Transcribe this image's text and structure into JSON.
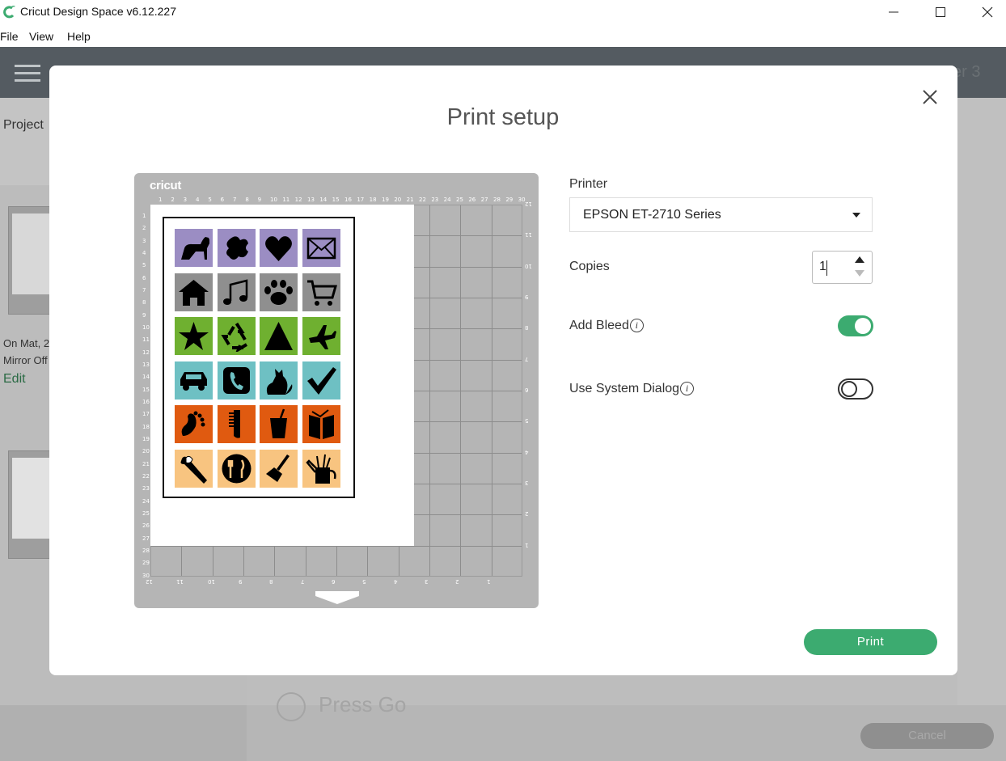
{
  "window": {
    "title": "Cricut Design Space  v6.12.227",
    "menu": [
      "File",
      "View",
      "Help"
    ]
  },
  "background": {
    "header_right": "er 3",
    "left_panel": {
      "project_label": "Project",
      "mat_info_1": "On Mat, 2",
      "mat_info_2": "Mirror Off",
      "edit_label": "Edit"
    },
    "step_label": "Press Go",
    "cancel_label": "Cancel"
  },
  "modal": {
    "title": "Print setup",
    "mat": {
      "brand": "cricut",
      "top_ruler": [
        "1",
        "2",
        "3",
        "4",
        "5",
        "6",
        "7",
        "8",
        "9",
        "10",
        "11",
        "12",
        "13",
        "14",
        "15",
        "16",
        "17",
        "18",
        "19",
        "20",
        "21",
        "22",
        "23",
        "24",
        "25",
        "26",
        "27",
        "28",
        "29",
        "30"
      ],
      "left_ruler": [
        "1",
        "2",
        "3",
        "4",
        "5",
        "6",
        "7",
        "8",
        "9",
        "10",
        "11",
        "12",
        "13",
        "14",
        "15",
        "16",
        "17",
        "18",
        "19",
        "20",
        "21",
        "22",
        "23",
        "24",
        "25",
        "26",
        "27",
        "28",
        "29",
        "30"
      ],
      "bottom_ruler": [
        "12",
        "11",
        "10",
        "9",
        "8",
        "7",
        "6",
        "5",
        "4",
        "3",
        "2",
        "1"
      ],
      "right_ruler": [
        "12",
        "11",
        "10",
        "9",
        "8",
        "7",
        "6",
        "5",
        "4",
        "3",
        "2",
        "1"
      ],
      "icons": [
        {
          "name": "dog-icon",
          "color": "#9b8dc3"
        },
        {
          "name": "puzzle-piece-icon",
          "color": "#9b8dc3"
        },
        {
          "name": "heart-icon",
          "color": "#9b8dc3"
        },
        {
          "name": "envelope-icon",
          "color": "#9b8dc3"
        },
        {
          "name": "house-icon",
          "color": "#8f8f8f"
        },
        {
          "name": "music-note-icon",
          "color": "#8f8f8f"
        },
        {
          "name": "paw-print-icon",
          "color": "#8f8f8f"
        },
        {
          "name": "shopping-cart-icon",
          "color": "#8f8f8f"
        },
        {
          "name": "star-icon",
          "color": "#6fb030"
        },
        {
          "name": "recycle-icon",
          "color": "#6fb030"
        },
        {
          "name": "triangle-icon",
          "color": "#6fb030"
        },
        {
          "name": "airplane-icon",
          "color": "#6fb030"
        },
        {
          "name": "car-icon",
          "color": "#6ec0c3"
        },
        {
          "name": "phone-icon",
          "color": "#6ec0c3"
        },
        {
          "name": "cat-icon",
          "color": "#6ec0c3"
        },
        {
          "name": "checkmark-icon",
          "color": "#6ec0c3"
        },
        {
          "name": "footprint-icon",
          "color": "#e05a10"
        },
        {
          "name": "comb-icon",
          "color": "#e05a10"
        },
        {
          "name": "drink-cup-icon",
          "color": "#e05a10"
        },
        {
          "name": "book-icon",
          "color": "#e05a10"
        },
        {
          "name": "toothbrush-icon",
          "color": "#f8c480"
        },
        {
          "name": "plate-fork-knife-icon",
          "color": "#f8c480"
        },
        {
          "name": "broom-icon",
          "color": "#f8c480"
        },
        {
          "name": "watering-can-icon",
          "color": "#f8c480"
        }
      ]
    },
    "printer_label": "Printer",
    "printer_value": "EPSON ET-2710 Series",
    "copies_label": "Copies",
    "copies_value": "1",
    "add_bleed_label": "Add Bleed",
    "add_bleed_on": true,
    "system_dialog_label": "Use System Dialog",
    "system_dialog_on": false,
    "info_glyph": "i",
    "print_label": "Print"
  },
  "colors": {
    "accent_green": "#3cab70",
    "header_dark": "#545b61"
  }
}
